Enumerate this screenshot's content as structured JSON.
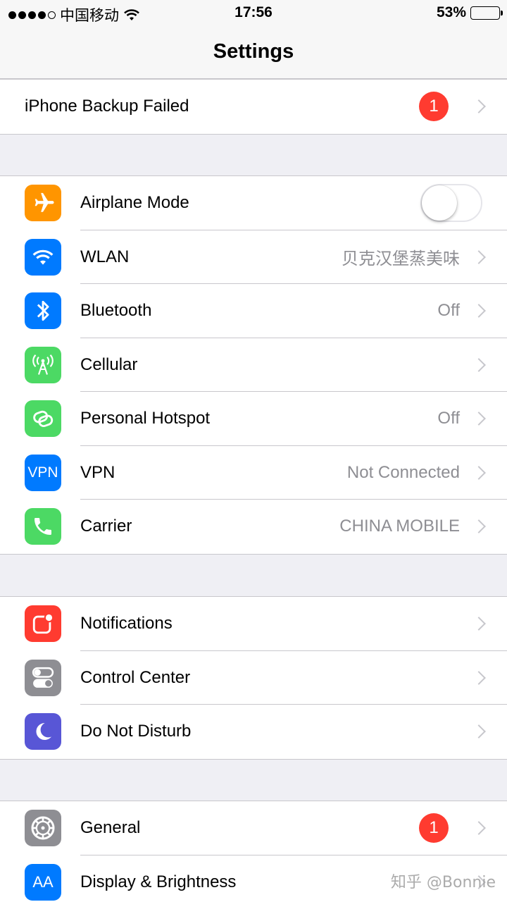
{
  "status_bar": {
    "carrier": "中国移动",
    "time": "17:56",
    "battery_percent": "53%",
    "battery_level": 0.53,
    "battery_color": "#f7c71e"
  },
  "nav": {
    "title": "Settings"
  },
  "backup": {
    "label": "iPhone Backup Failed",
    "badge": "1"
  },
  "network": {
    "airplane": {
      "label": "Airplane Mode",
      "icon": "airplane-icon",
      "color": "#ff9500",
      "toggle_on": false
    },
    "wlan": {
      "label": "WLAN",
      "value": "贝克汉堡蒸美味",
      "icon": "wifi-icon",
      "color": "#007aff"
    },
    "bluetooth": {
      "label": "Bluetooth",
      "value": "Off",
      "icon": "bluetooth-icon",
      "color": "#007aff"
    },
    "cellular": {
      "label": "Cellular",
      "icon": "antenna-icon",
      "color": "#4cd964"
    },
    "hotspot": {
      "label": "Personal Hotspot",
      "value": "Off",
      "icon": "link-icon",
      "color": "#4cd964"
    },
    "vpn": {
      "label": "VPN",
      "value": "Not Connected",
      "icon_text": "VPN",
      "color": "#007aff"
    },
    "carrier": {
      "label": "Carrier",
      "value": "CHINA MOBILE",
      "icon": "phone-icon",
      "color": "#4cd964"
    }
  },
  "system": {
    "notifications": {
      "label": "Notifications",
      "icon": "notifications-icon",
      "color": "#ff3b30"
    },
    "control_center": {
      "label": "Control Center",
      "icon": "toggles-icon",
      "color": "#8e8e93"
    },
    "dnd": {
      "label": "Do Not Disturb",
      "icon": "moon-icon",
      "color": "#5856d6"
    }
  },
  "general": {
    "general": {
      "label": "General",
      "badge": "1",
      "icon": "gear-icon",
      "color": "#8e8e93"
    },
    "display": {
      "label": "Display & Brightness",
      "icon_text": "AA",
      "color": "#007aff"
    }
  },
  "watermark": "知乎 @Bonnie"
}
